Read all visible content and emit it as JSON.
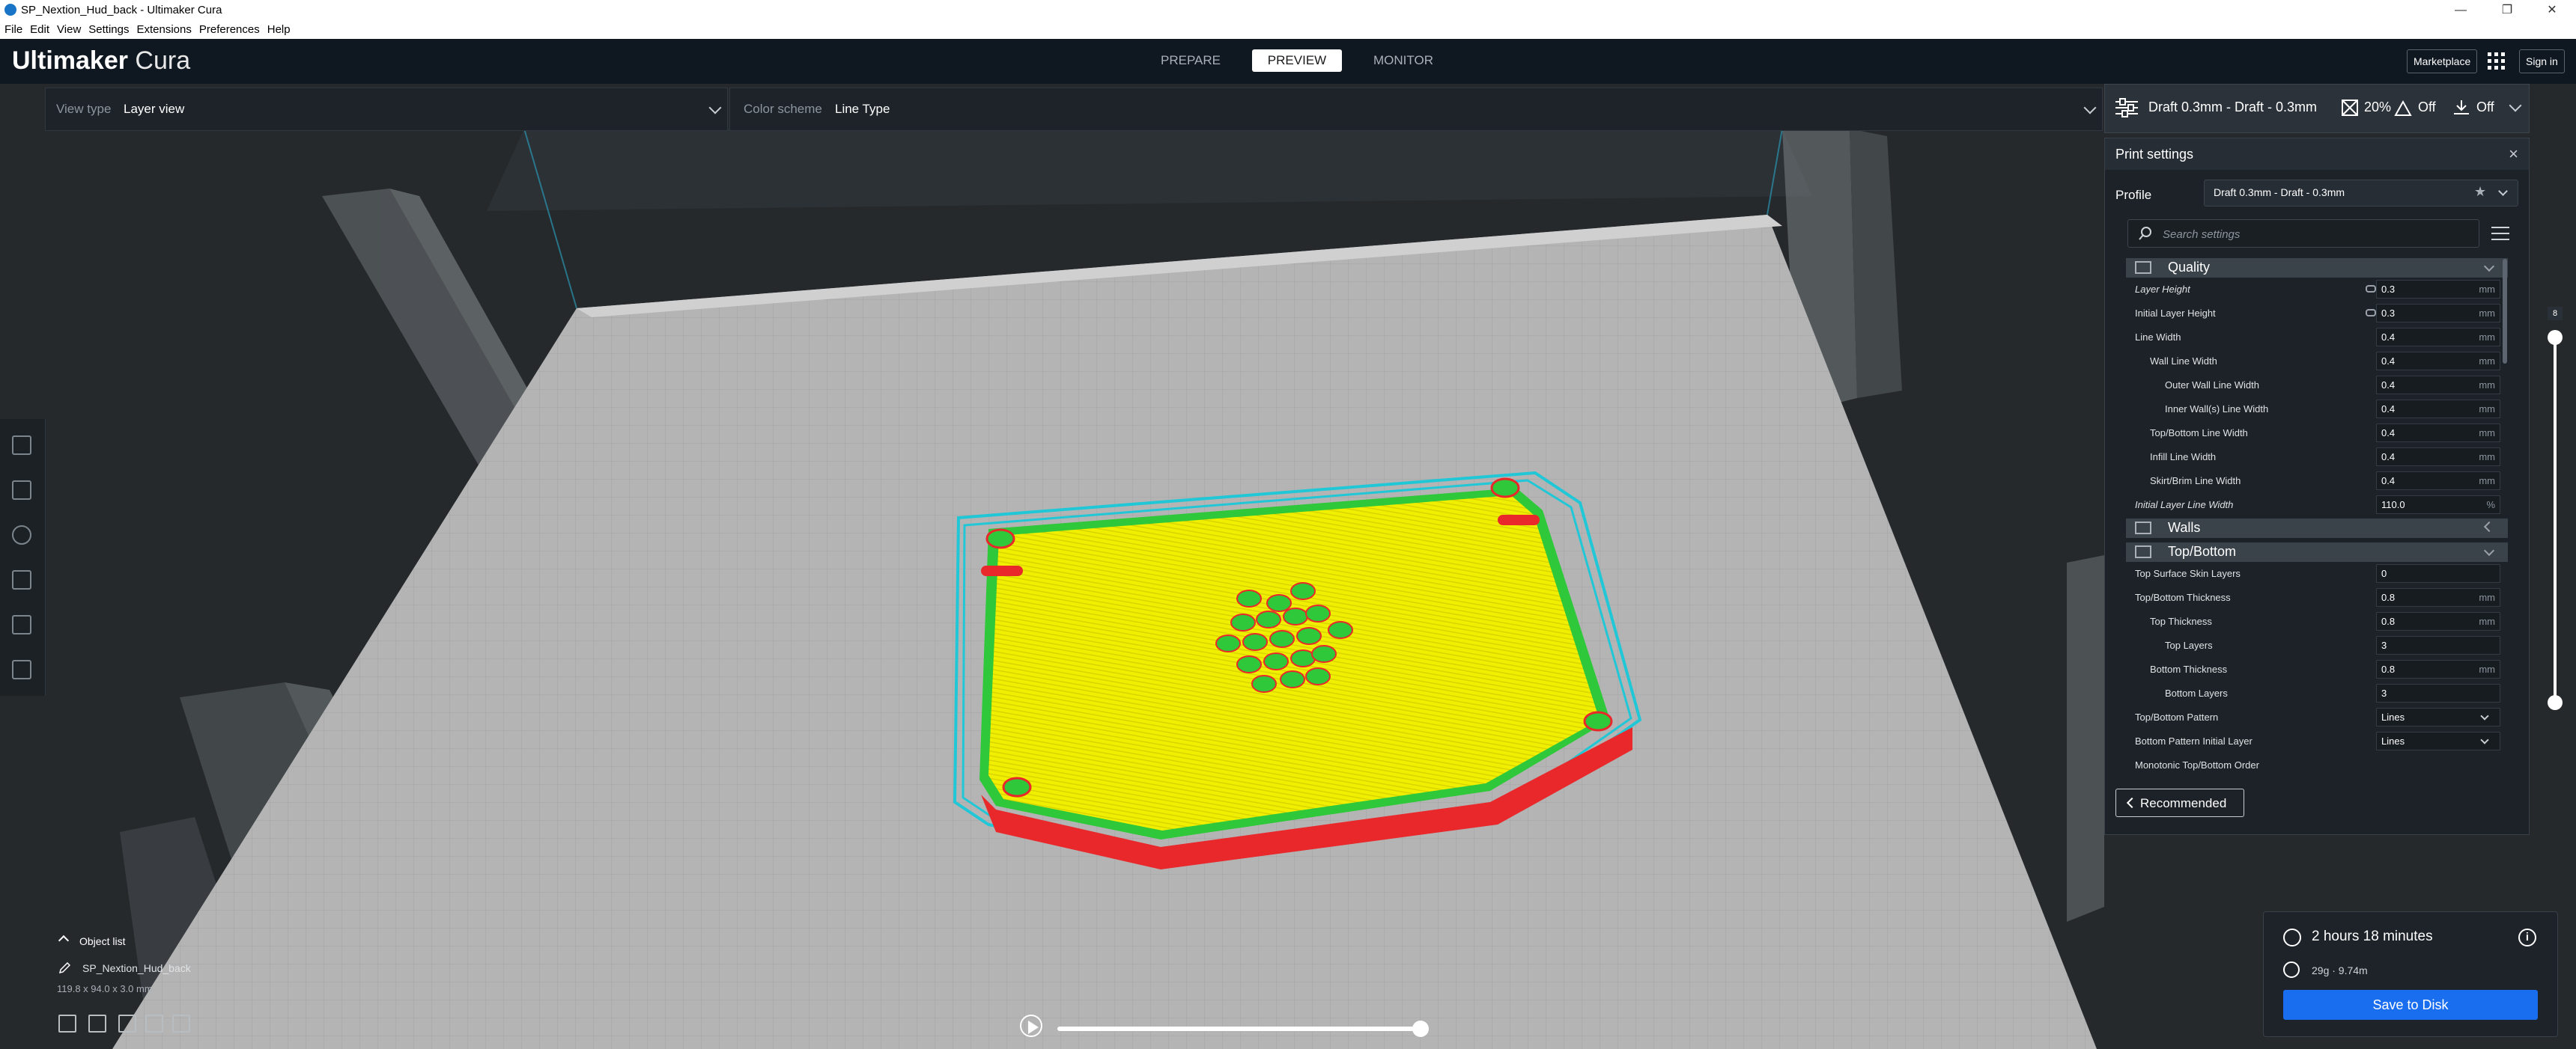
{
  "window": {
    "title": "SP_Nextion_Hud_back - Ultimaker Cura",
    "controls": [
      "—",
      "❐",
      "✕"
    ]
  },
  "menu": [
    "File",
    "Edit",
    "View",
    "Settings",
    "Extensions",
    "Preferences",
    "Help"
  ],
  "header": {
    "brand_bold": "Ultimaker",
    "brand_light": "Cura",
    "stages": [
      "PREPARE",
      "PREVIEW",
      "MONITOR"
    ],
    "active_stage": "PREVIEW",
    "marketplace": "Marketplace",
    "sign_in": "Sign in"
  },
  "toolbar": {
    "view_type_label": "View type",
    "view_type_value": "Layer view",
    "color_scheme_label": "Color scheme",
    "color_scheme_value": "Line Type"
  },
  "print_selector": {
    "profile": "Draft 0.3mm - Draft - 0.3mm",
    "infill": "20%",
    "support": "Off",
    "adhesion": "Off"
  },
  "panel": {
    "title": "Print settings",
    "profile_label": "Profile",
    "profile_value": "Draft 0.3mm - Draft - 0.3mm",
    "search_placeholder": "Search settings",
    "recommended": "Recommended",
    "categories": {
      "quality": "Quality",
      "walls": "Walls",
      "topbottom": "Top/Bottom"
    },
    "quality_rows": [
      {
        "label": "Layer Height",
        "value": "0.3",
        "unit": "mm"
      },
      {
        "label": "Initial Layer Height",
        "value": "0.3",
        "unit": "mm"
      },
      {
        "label": "Line Width",
        "value": "0.4",
        "unit": "mm"
      },
      {
        "label": "Wall Line Width",
        "value": "0.4",
        "unit": "mm"
      },
      {
        "label": "Outer Wall Line Width",
        "value": "0.4",
        "unit": "mm"
      },
      {
        "label": "Inner Wall(s) Line Width",
        "value": "0.4",
        "unit": "mm"
      },
      {
        "label": "Top/Bottom Line Width",
        "value": "0.4",
        "unit": "mm"
      },
      {
        "label": "Infill Line Width",
        "value": "0.4",
        "unit": "mm"
      },
      {
        "label": "Skirt/Brim Line Width",
        "value": "0.4",
        "unit": "mm"
      },
      {
        "label": "Initial Layer Line Width",
        "value": "110.0",
        "unit": "%"
      }
    ],
    "topbottom_rows": [
      {
        "label": "Top Surface Skin Layers",
        "value": "0",
        "unit": ""
      },
      {
        "label": "Top/Bottom Thickness",
        "value": "0.8",
        "unit": "mm"
      },
      {
        "label": "Top Thickness",
        "value": "0.8",
        "unit": "mm"
      },
      {
        "label": "Top Layers",
        "value": "3",
        "unit": ""
      },
      {
        "label": "Bottom Thickness",
        "value": "0.8",
        "unit": "mm"
      },
      {
        "label": "Bottom Layers",
        "value": "3",
        "unit": ""
      },
      {
        "label": "Top/Bottom Pattern",
        "value": "Lines",
        "unit": ""
      },
      {
        "label": "Bottom Pattern Initial Layer",
        "value": "Lines",
        "unit": ""
      },
      {
        "label": "Monotonic Top/Bottom Order",
        "value": "",
        "unit": ""
      }
    ]
  },
  "layer_slider": {
    "current_layer": "8"
  },
  "object_list": {
    "title": "Object list",
    "object_name": "SP_Nextion_Hud_back",
    "dimensions": "119.8 x 94.0 x 3.0 mm"
  },
  "output": {
    "print_time": "2 hours 18 minutes",
    "material": "29g · 9.74m",
    "save_button": "Save to Disk"
  },
  "colors": {
    "infill": "#f0ef00",
    "wall_outer": "#e8282a",
    "wall_inner": "#2fc83a",
    "skirt": "#20c7d6",
    "accent": "#196ef0"
  }
}
